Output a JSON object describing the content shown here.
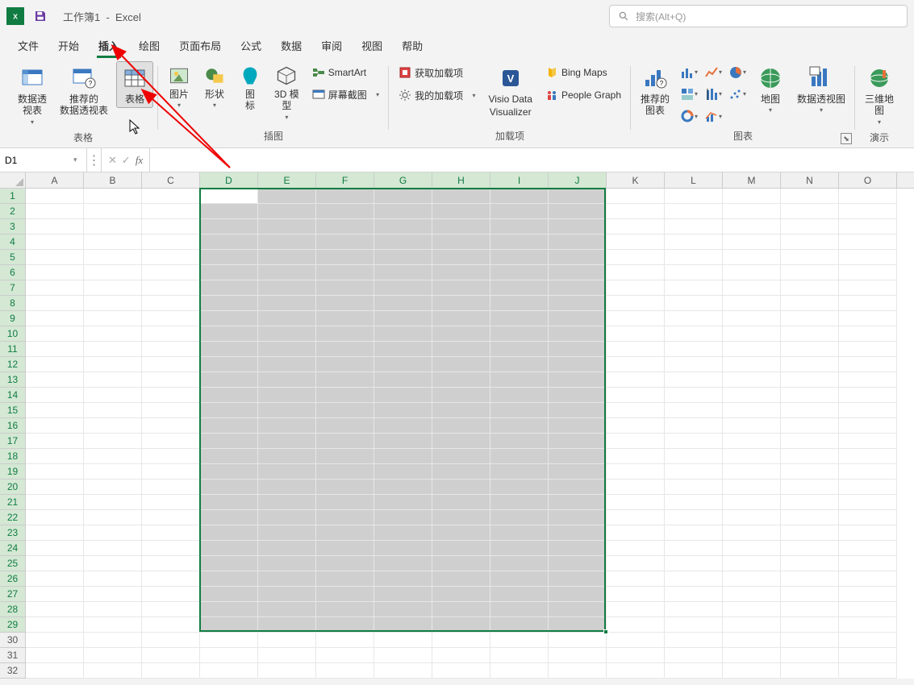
{
  "title": {
    "workbook": "工作簿1",
    "sep": "-",
    "app": "Excel"
  },
  "search": {
    "placeholder": "搜索(Alt+Q)"
  },
  "menu": {
    "items": [
      "文件",
      "开始",
      "插入",
      "绘图",
      "页面布局",
      "公式",
      "数据",
      "审阅",
      "视图",
      "帮助"
    ],
    "active_index": 2
  },
  "ribbon": {
    "tables": {
      "pivot": "数据透\n视表",
      "recommended_pivot": "推荐的\n数据透视表",
      "table": "表格",
      "group": "表格"
    },
    "illustrations": {
      "pictures": "图片",
      "shapes": "形状",
      "icons": "图\n标",
      "model3d": "3D 模\n型",
      "smartart": "SmartArt",
      "screenshot": "屏幕截图",
      "group": "插图"
    },
    "addins": {
      "getaddins": "获取加载项",
      "myaddins": "我的加载项",
      "visio_l1": "Visio Data",
      "visio_l2": "Visualizer",
      "bingmaps": "Bing Maps",
      "peoplegraph": "People Graph",
      "group": "加载项"
    },
    "charts": {
      "recommended": "推荐的\n图表",
      "maps": "地图",
      "pivotchart": "数据透视图",
      "group": "图表"
    },
    "tours": {
      "map3d": "三维地\n图",
      "group": "演示"
    }
  },
  "formula": {
    "namebox": "D1"
  },
  "grid": {
    "columns": [
      "A",
      "B",
      "C",
      "D",
      "E",
      "F",
      "G",
      "H",
      "I",
      "J",
      "K",
      "L",
      "M",
      "N",
      "O"
    ],
    "rows": 32,
    "sel_cols_start": 3,
    "sel_cols_end": 9,
    "sel_rows_start": 1,
    "sel_rows_end": 29
  }
}
